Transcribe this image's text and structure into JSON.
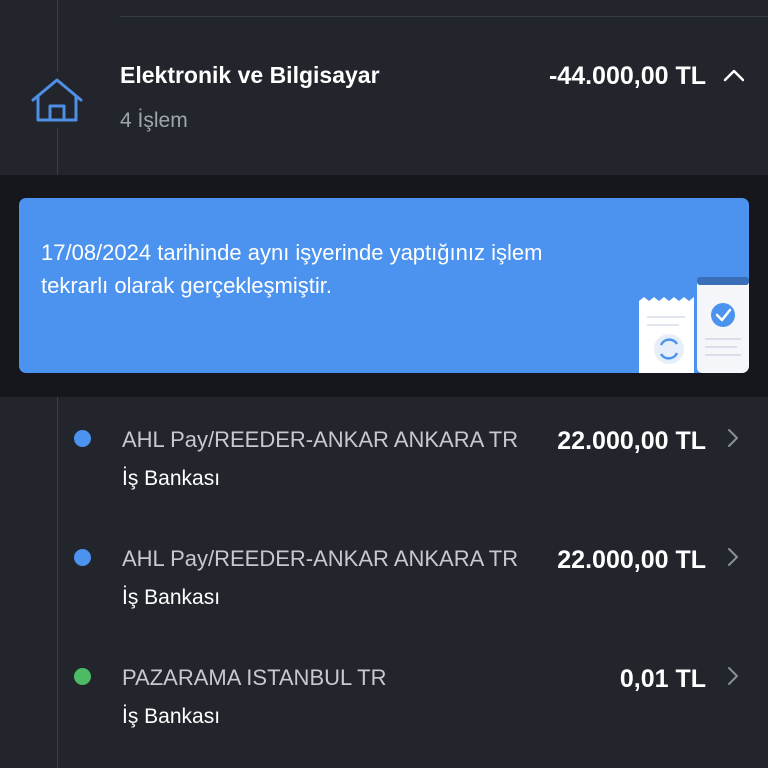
{
  "category": {
    "title": "Elektronik ve Bilgisayar",
    "subtitle": "4 İşlem",
    "amount": "-44.000,00 TL",
    "icon": "home-icon",
    "expand_icon": "chevron-up-icon"
  },
  "banner": {
    "text": "17/08/2024 tarihinde aynı işyerinde yaptığınız işlem tekrarlı olarak gerçekleşmiştir.",
    "background": "#4b93ee",
    "art_icon": "duplicate-receipt-illustration"
  },
  "transactions": [
    {
      "merchant": "AHL Pay/REEDER-ANKAR ANKARA TR",
      "bank": "İş Bankası",
      "amount": "22.000,00 TL",
      "dot_color": "#4b93ee"
    },
    {
      "merchant": "AHL Pay/REEDER-ANKAR ANKARA TR",
      "bank": "İş Bankası",
      "amount": "22.000,00 TL",
      "dot_color": "#4b93ee"
    },
    {
      "merchant": "PAZARAMA ISTANBUL TR",
      "bank": "İş Bankası",
      "amount": "0,01 TL",
      "dot_color": "#4dbb63"
    }
  ],
  "colors": {
    "background": "#22252c",
    "banner_band": "#15171c",
    "accent_blue": "#4b93ee",
    "accent_green": "#4dbb63",
    "icon_outline": "#4f8fe6"
  }
}
